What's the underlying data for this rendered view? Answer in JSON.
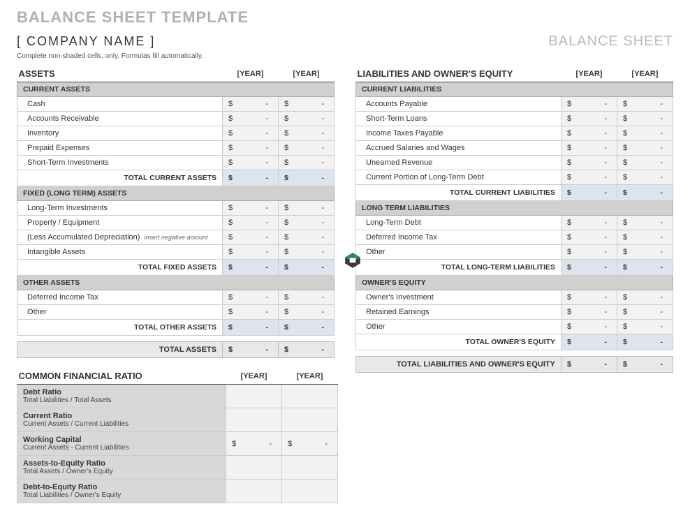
{
  "page_title": "BALANCE SHEET TEMPLATE",
  "company_name": "[ COMPANY NAME ]",
  "sheet_label": "BALANCE SHEET",
  "instructions": "Complete non-shaded cells, only.  Formulas fill automatically.",
  "year1": "[YEAR]",
  "year2": "[YEAR]",
  "currency": "$",
  "dash": "-",
  "assets": {
    "title": "ASSETS",
    "current": {
      "header": "CURRENT ASSETS",
      "rows": [
        "Cash",
        "Accounts Receivable",
        "Inventory",
        "Prepaid Expenses",
        "Short-Term Investments"
      ],
      "total": "TOTAL CURRENT ASSETS"
    },
    "fixed": {
      "header": "FIXED (LONG TERM) ASSETS",
      "rows": [
        "Long-Term Investments",
        "Property / Equipment",
        "(Less Accumulated Depreciation)",
        "Intangible Assets"
      ],
      "hint": "insert negative amount",
      "total": "TOTAL FIXED ASSETS"
    },
    "other": {
      "header": "OTHER ASSETS",
      "rows": [
        "Deferred Income Tax",
        "Other"
      ],
      "total": "TOTAL OTHER ASSETS"
    },
    "grand_total": "TOTAL ASSETS"
  },
  "liab": {
    "title": "LIABILITIES AND OWNER'S EQUITY",
    "current": {
      "header": "CURRENT LIABILITIES",
      "rows": [
        "Accounts Payable",
        "Short-Term Loans",
        "Income Taxes Payable",
        "Accrued Salaries and Wages",
        "Unearned Revenue",
        "Current Portion of Long-Term Debt"
      ],
      "total": "TOTAL CURRENT LIABILITIES"
    },
    "longterm": {
      "header": "LONG TERM LIABILITIES",
      "rows": [
        "Long-Term Debt",
        "Deferred Income Tax",
        "Other"
      ],
      "total": "TOTAL LONG-TERM LIABILITIES"
    },
    "equity": {
      "header": "OWNER'S EQUITY",
      "rows": [
        "Owner's Investment",
        "Retained Earnings",
        "Other"
      ],
      "total": "TOTAL OWNER'S EQUITY"
    },
    "grand_total": "TOTAL LIABILITIES AND OWNER'S EQUITY"
  },
  "ratios": {
    "title": "COMMON FINANCIAL RATIO",
    "items": [
      {
        "name": "Debt Ratio",
        "desc": "Total Liabilities / Total Assets",
        "show_currency": false
      },
      {
        "name": "Current Ratio",
        "desc": "Current Assets / Current Liabilities",
        "show_currency": false
      },
      {
        "name": "Working Capital",
        "desc": "Current Assets - Current Liabilities",
        "show_currency": true
      },
      {
        "name": "Assets-to-Equity Ratio",
        "desc": "Total Assets / Owner's Equity",
        "show_currency": false
      },
      {
        "name": "Debt-to-Equity Ratio",
        "desc": "Total Liabilities / Owner's Equity",
        "show_currency": false
      }
    ]
  }
}
